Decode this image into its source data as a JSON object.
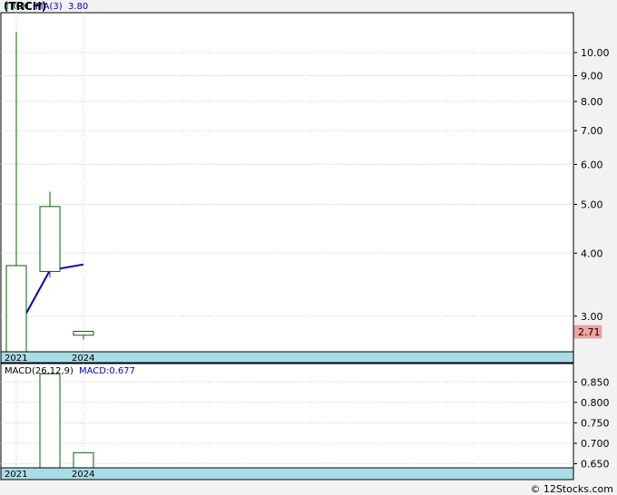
{
  "header": {
    "title": "(TRCH)",
    "watermark": "© 12Stocks.com"
  },
  "colors": {
    "candle": "#006400",
    "ma_line": "#0000cc",
    "grid": "#c8c8c8",
    "date_band": "#a8dce6",
    "last_price_bg": "#f4a0a0",
    "macd_bar": "#006400"
  },
  "chart_data": [
    {
      "type": "candlestick",
      "name": "price",
      "legend": {
        "symbol": "TRCH",
        "ma_label": "MA(3)",
        "ma_value": "3.80"
      },
      "y_scale": "log",
      "ylim": [
        2.55,
        12.0
      ],
      "y_ticks": [
        "10.00",
        "9.00",
        "8.00",
        "7.00",
        "6.00",
        "5.00",
        "4.00",
        "3.00"
      ],
      "y_tick_values": [
        10,
        9,
        8,
        7,
        6,
        5,
        4,
        3
      ],
      "x_labels": [
        "2021",
        "2024"
      ],
      "last_price": "2.71",
      "candles": [
        {
          "open": 2.55,
          "high": 11.0,
          "low": 2.55,
          "close": 3.78
        },
        {
          "open": 3.68,
          "high": 5.3,
          "low": 3.58,
          "close": 4.95
        },
        {
          "open": 2.75,
          "high": 2.78,
          "low": 2.7,
          "close": 2.8
        }
      ],
      "ma": [
        2.8,
        3.7,
        3.8
      ]
    },
    {
      "type": "bar",
      "name": "macd",
      "legend": {
        "label": "MACD(26,12,9)",
        "value_label": "MACD:0.677"
      },
      "ylim": [
        0.64,
        0.895
      ],
      "y_ticks": [
        "0.850",
        "0.800",
        "0.750",
        "0.700",
        "0.650"
      ],
      "y_tick_values": [
        0.85,
        0.8,
        0.75,
        0.7,
        0.65
      ],
      "x_labels": [
        "2021",
        "2024"
      ],
      "values": [
        0.87,
        0.677
      ]
    }
  ]
}
